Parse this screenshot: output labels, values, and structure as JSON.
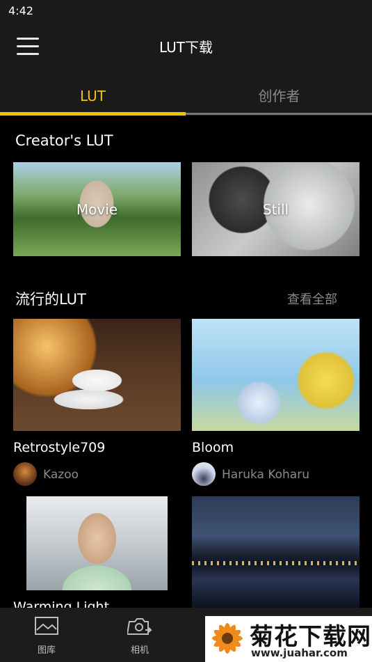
{
  "status_bar": {
    "time": "4:42"
  },
  "header": {
    "title": "LUT下载",
    "menu_icon": "menu-icon"
  },
  "tabs": [
    {
      "label": "LUT",
      "active": true
    },
    {
      "label": "创作者",
      "active": false
    }
  ],
  "creators_section": {
    "title": "Creator's LUT",
    "cards": [
      {
        "label": "Movie"
      },
      {
        "label": "Still"
      }
    ]
  },
  "popular_section": {
    "title": "流行的LUT",
    "see_all": "查看全部",
    "items": [
      {
        "title": "Retrostyle709",
        "author": "Kazoo"
      },
      {
        "title": "Bloom",
        "author": "Haruka Koharu"
      },
      {
        "title": "Warming Light"
      },
      {
        "title": ""
      }
    ]
  },
  "bottom_nav": [
    {
      "label": "图库",
      "icon": "gallery-icon"
    },
    {
      "label": "相机",
      "icon": "camera-switch-icon"
    }
  ],
  "watermark": {
    "title": "菊花下载网",
    "url": "www.juahar.com"
  },
  "colors": {
    "accent": "#f2c400",
    "background": "#000000",
    "bar": "#1a1a1a",
    "muted_text": "#8a8a8a"
  }
}
